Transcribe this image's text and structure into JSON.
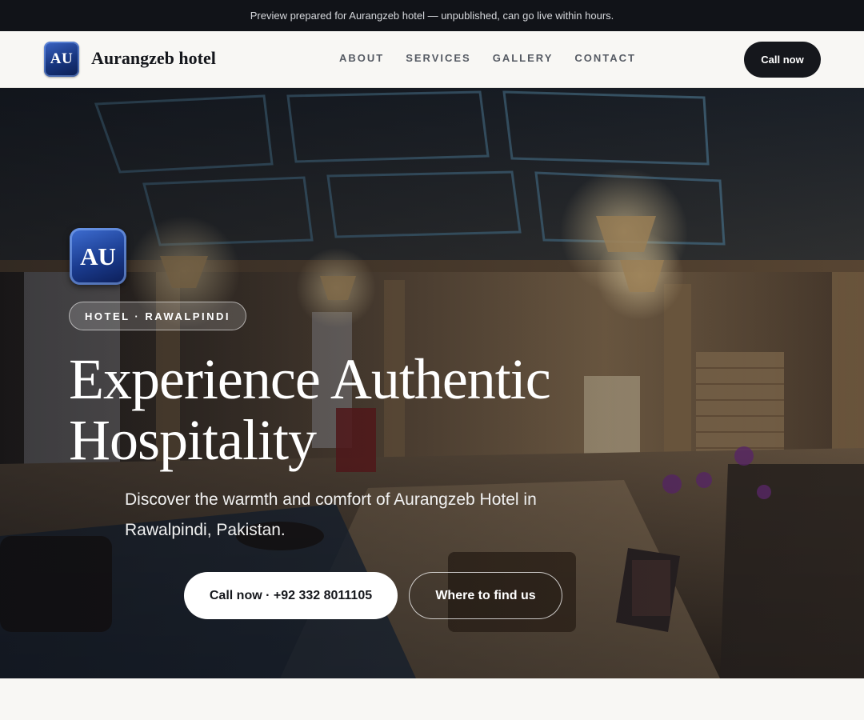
{
  "banner": {
    "text": "Preview prepared for Aurangzeb hotel — unpublished, can go live within hours."
  },
  "header": {
    "logo_text": "AU",
    "brand_name": "Aurangzeb hotel",
    "nav": [
      "ABOUT",
      "SERVICES",
      "GALLERY",
      "CONTACT"
    ],
    "call_label": "Call now"
  },
  "hero": {
    "logo_text": "AU",
    "tag": "HOTEL · RAWALPINDI",
    "headline": "Experience Authentic Hospitality",
    "subtitle": "Discover the warmth and comfort of Aurangzeb Hotel in Rawalpindi, Pakistan.",
    "primary_cta": "Call now · +92 332 8011105",
    "secondary_cta": "Where to find us"
  },
  "colors": {
    "banner_bg": "#111318",
    "nav_bg": "#f8f7f4",
    "primary_dark": "#15171c",
    "logo_blue": "#1a3b8e"
  }
}
